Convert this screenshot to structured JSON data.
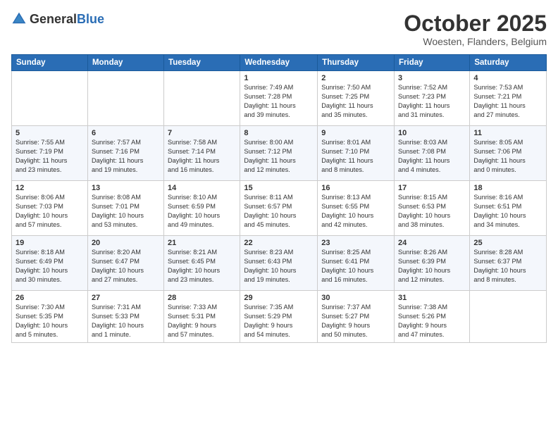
{
  "header": {
    "logo_general": "General",
    "logo_blue": "Blue",
    "title": "October 2025",
    "subtitle": "Woesten, Flanders, Belgium"
  },
  "days_of_week": [
    "Sunday",
    "Monday",
    "Tuesday",
    "Wednesday",
    "Thursday",
    "Friday",
    "Saturday"
  ],
  "weeks": [
    [
      {
        "day": "",
        "info": ""
      },
      {
        "day": "",
        "info": ""
      },
      {
        "day": "",
        "info": ""
      },
      {
        "day": "1",
        "info": "Sunrise: 7:49 AM\nSunset: 7:28 PM\nDaylight: 11 hours\nand 39 minutes."
      },
      {
        "day": "2",
        "info": "Sunrise: 7:50 AM\nSunset: 7:25 PM\nDaylight: 11 hours\nand 35 minutes."
      },
      {
        "day": "3",
        "info": "Sunrise: 7:52 AM\nSunset: 7:23 PM\nDaylight: 11 hours\nand 31 minutes."
      },
      {
        "day": "4",
        "info": "Sunrise: 7:53 AM\nSunset: 7:21 PM\nDaylight: 11 hours\nand 27 minutes."
      }
    ],
    [
      {
        "day": "5",
        "info": "Sunrise: 7:55 AM\nSunset: 7:19 PM\nDaylight: 11 hours\nand 23 minutes."
      },
      {
        "day": "6",
        "info": "Sunrise: 7:57 AM\nSunset: 7:16 PM\nDaylight: 11 hours\nand 19 minutes."
      },
      {
        "day": "7",
        "info": "Sunrise: 7:58 AM\nSunset: 7:14 PM\nDaylight: 11 hours\nand 16 minutes."
      },
      {
        "day": "8",
        "info": "Sunrise: 8:00 AM\nSunset: 7:12 PM\nDaylight: 11 hours\nand 12 minutes."
      },
      {
        "day": "9",
        "info": "Sunrise: 8:01 AM\nSunset: 7:10 PM\nDaylight: 11 hours\nand 8 minutes."
      },
      {
        "day": "10",
        "info": "Sunrise: 8:03 AM\nSunset: 7:08 PM\nDaylight: 11 hours\nand 4 minutes."
      },
      {
        "day": "11",
        "info": "Sunrise: 8:05 AM\nSunset: 7:06 PM\nDaylight: 11 hours\nand 0 minutes."
      }
    ],
    [
      {
        "day": "12",
        "info": "Sunrise: 8:06 AM\nSunset: 7:03 PM\nDaylight: 10 hours\nand 57 minutes."
      },
      {
        "day": "13",
        "info": "Sunrise: 8:08 AM\nSunset: 7:01 PM\nDaylight: 10 hours\nand 53 minutes."
      },
      {
        "day": "14",
        "info": "Sunrise: 8:10 AM\nSunset: 6:59 PM\nDaylight: 10 hours\nand 49 minutes."
      },
      {
        "day": "15",
        "info": "Sunrise: 8:11 AM\nSunset: 6:57 PM\nDaylight: 10 hours\nand 45 minutes."
      },
      {
        "day": "16",
        "info": "Sunrise: 8:13 AM\nSunset: 6:55 PM\nDaylight: 10 hours\nand 42 minutes."
      },
      {
        "day": "17",
        "info": "Sunrise: 8:15 AM\nSunset: 6:53 PM\nDaylight: 10 hours\nand 38 minutes."
      },
      {
        "day": "18",
        "info": "Sunrise: 8:16 AM\nSunset: 6:51 PM\nDaylight: 10 hours\nand 34 minutes."
      }
    ],
    [
      {
        "day": "19",
        "info": "Sunrise: 8:18 AM\nSunset: 6:49 PM\nDaylight: 10 hours\nand 30 minutes."
      },
      {
        "day": "20",
        "info": "Sunrise: 8:20 AM\nSunset: 6:47 PM\nDaylight: 10 hours\nand 27 minutes."
      },
      {
        "day": "21",
        "info": "Sunrise: 8:21 AM\nSunset: 6:45 PM\nDaylight: 10 hours\nand 23 minutes."
      },
      {
        "day": "22",
        "info": "Sunrise: 8:23 AM\nSunset: 6:43 PM\nDaylight: 10 hours\nand 19 minutes."
      },
      {
        "day": "23",
        "info": "Sunrise: 8:25 AM\nSunset: 6:41 PM\nDaylight: 10 hours\nand 16 minutes."
      },
      {
        "day": "24",
        "info": "Sunrise: 8:26 AM\nSunset: 6:39 PM\nDaylight: 10 hours\nand 12 minutes."
      },
      {
        "day": "25",
        "info": "Sunrise: 8:28 AM\nSunset: 6:37 PM\nDaylight: 10 hours\nand 8 minutes."
      }
    ],
    [
      {
        "day": "26",
        "info": "Sunrise: 7:30 AM\nSunset: 5:35 PM\nDaylight: 10 hours\nand 5 minutes."
      },
      {
        "day": "27",
        "info": "Sunrise: 7:31 AM\nSunset: 5:33 PM\nDaylight: 10 hours\nand 1 minute."
      },
      {
        "day": "28",
        "info": "Sunrise: 7:33 AM\nSunset: 5:31 PM\nDaylight: 9 hours\nand 57 minutes."
      },
      {
        "day": "29",
        "info": "Sunrise: 7:35 AM\nSunset: 5:29 PM\nDaylight: 9 hours\nand 54 minutes."
      },
      {
        "day": "30",
        "info": "Sunrise: 7:37 AM\nSunset: 5:27 PM\nDaylight: 9 hours\nand 50 minutes."
      },
      {
        "day": "31",
        "info": "Sunrise: 7:38 AM\nSunset: 5:26 PM\nDaylight: 9 hours\nand 47 minutes."
      },
      {
        "day": "",
        "info": ""
      }
    ]
  ]
}
